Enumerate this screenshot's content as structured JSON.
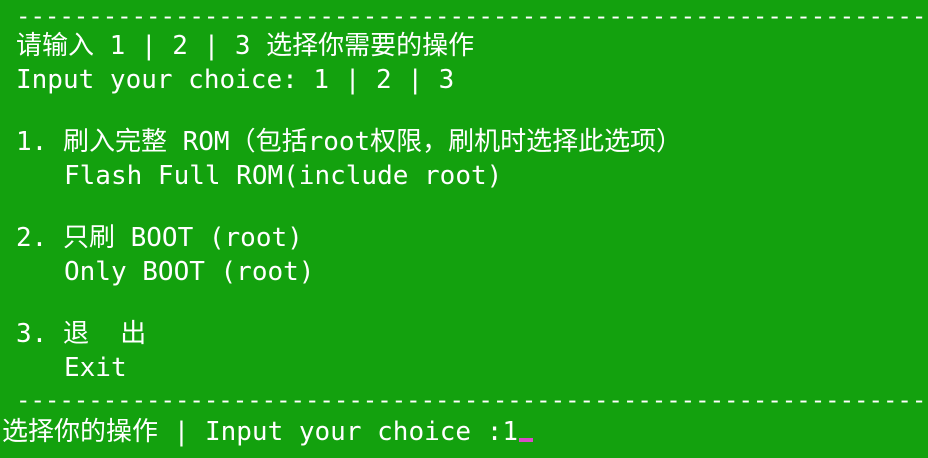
{
  "console": {
    "divider": "--------------------------------------------------------------------------",
    "header": {
      "cn": "请输入 1 | 2 | 3 选择你需要的操作",
      "en": "Input your choice: 1 | 2 | 3"
    },
    "options": [
      {
        "cn": "1. 刷入完整 ROM（包括root权限，刷机时选择此选项）",
        "en": "Flash Full ROM(include root)"
      },
      {
        "cn": "2. 只刷 BOOT (root)",
        "en": "Only BOOT (root)"
      },
      {
        "cn": "3. 退  出",
        "en": "Exit"
      }
    ],
    "prompt": {
      "text": "选择你的操作 | Input your choice :",
      "input_value": "1"
    }
  },
  "colors": {
    "background": "#13a10e",
    "text": "#ffffff",
    "cursor": "#d84cc7"
  }
}
